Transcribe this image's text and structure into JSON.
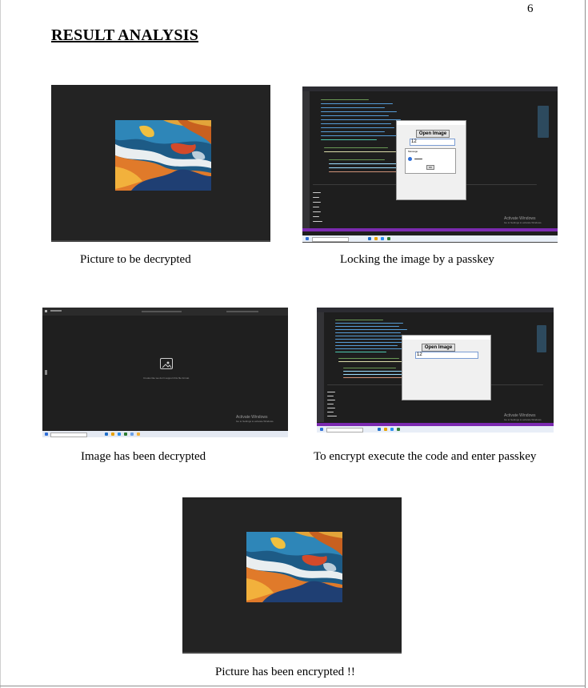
{
  "page_number": "6",
  "heading": "RESULT ANALYSIS",
  "figures": [
    {
      "caption": "Picture to be decrypted"
    },
    {
      "caption": "Locking the image by a passkey",
      "dialog": {
        "open_button": "Open Image",
        "passkey_value": "12",
        "message_title": "Message",
        "message_ok": "OK"
      }
    },
    {
      "caption": "Image has been decrypted",
      "viewer": {
        "notice_line": "It looks like we don't support this file format."
      }
    },
    {
      "caption": "To encrypt execute the code and enter passkey",
      "dialog": {
        "open_button": "Open Image",
        "passkey_value": "12"
      }
    },
    {
      "caption": "Picture has been encrypted !!"
    }
  ],
  "watermark": {
    "line1": "Activate Windows",
    "line2": "Go to Settings to activate Windows."
  },
  "colors": {
    "dark_bg": "#232323",
    "vscode_bg": "#1e1e1e",
    "status_bar": "#7b2ab0",
    "taskbar": "#e4e9f2"
  }
}
